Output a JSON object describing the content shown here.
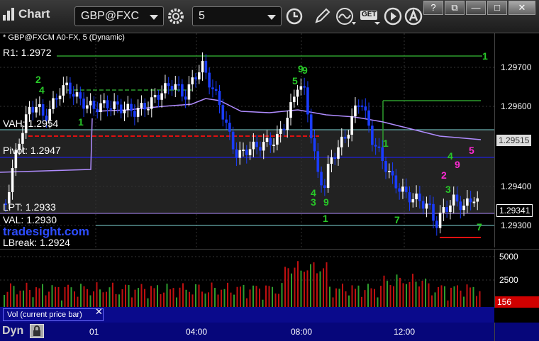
{
  "toolbar": {
    "app_title": "Chart",
    "symbol": "GBP@FXC",
    "interval": "5",
    "get_label": "GET"
  },
  "window_buttons": {
    "help": "?",
    "restore": "⧉",
    "minimize": "—",
    "maximize": "□",
    "close": "✕"
  },
  "chart": {
    "header": "* GBP@FXCM A0-FX, 5 (Dynamic)",
    "watermark": "tradesight.com",
    "levels": {
      "r1": "R1: 1.2972",
      "vah": "VAH: 1.2954",
      "pivot": "Pivot: 1.2947",
      "lpt": "LPT: 1.2933",
      "val": "VAL: 1.2930",
      "break": "LBreak: 1.2924"
    },
    "price_ticks": [
      "1.29700",
      "1.29600",
      "1.29400",
      "1.29300"
    ],
    "price_boxes": {
      "upper": "1.29515",
      "last": "1.29341"
    },
    "volume_ticks": [
      "5000",
      "2500"
    ],
    "volume_box": "156",
    "volume_label": "Vol (current price bar)",
    "time_ticks": [
      "01",
      "04:00",
      "08:00",
      "12:00"
    ],
    "dyn_label": "Dyn",
    "counts": [
      "1",
      "9",
      "9",
      "4",
      "3",
      "9",
      "1",
      "7",
      "2",
      "5",
      "3",
      "4",
      "9",
      "1",
      "7",
      "5",
      "2",
      "4",
      "1"
    ]
  },
  "colors": {
    "up_bar": "#ffffff",
    "down_bar": "#1a3cff",
    "ma_line": "#b08cff",
    "r1_line": "#2e9e2e",
    "vah_line": "#7fd7d7",
    "pivot_line": "#2020c0",
    "red_line": "#e01010",
    "vol_bar": "#c01010",
    "count_green": "#28c828",
    "count_magenta": "#ff2ad4"
  }
}
